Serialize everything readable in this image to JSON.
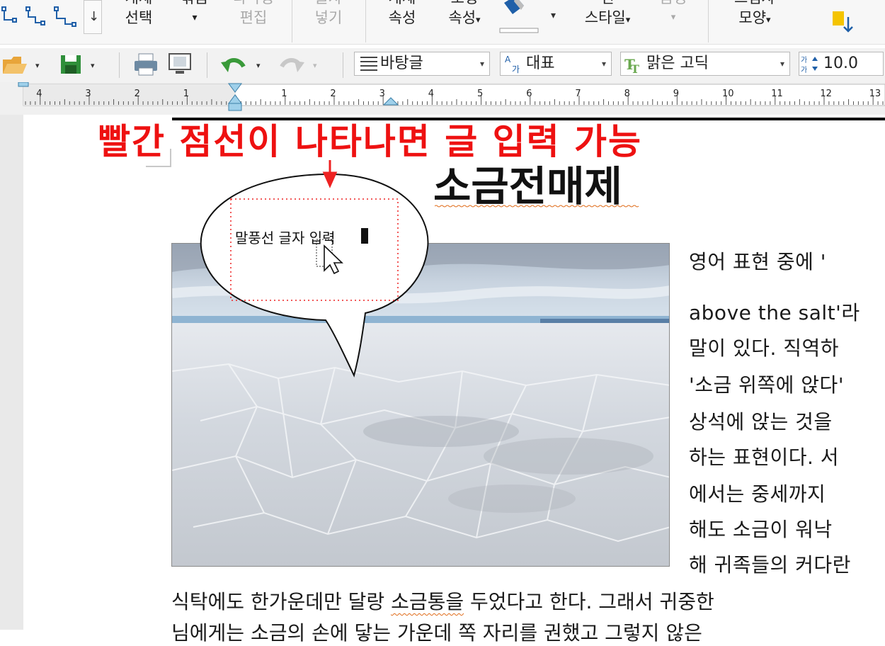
{
  "ribbon": {
    "group1_label": "",
    "items": [
      {
        "line1": "개체",
        "line2": "선택",
        "disabled": false
      },
      {
        "line1": "묶음",
        "line2": "",
        "disabled": false
      },
      {
        "line1": "다각형",
        "line2": "편집",
        "disabled": true
      },
      {
        "line1": "글자",
        "line2": "넣기",
        "disabled": true
      },
      {
        "line1": "개체",
        "line2": "속성",
        "disabled": false
      },
      {
        "line1": "도형",
        "line2": "속성",
        "disabled": false
      },
      {
        "line1": "선",
        "line2": "스타일",
        "disabled": false
      },
      {
        "line1": "음영",
        "line2": "",
        "disabled": true
      },
      {
        "line1": "그림자",
        "line2": "모양",
        "disabled": false
      }
    ],
    "dropdown_glyph": "▾",
    "down_arrow_glyph": "↓"
  },
  "toolbar": {
    "style_combo": "바탕글",
    "lang_combo": "대표",
    "font_combo": "맑은 고딕",
    "size_value": "10.0"
  },
  "ruler": {
    "left_numbers": [
      "4",
      "3",
      "2",
      "1"
    ],
    "right_numbers": [
      "1",
      "2",
      "3",
      "4",
      "5",
      "6",
      "7",
      "8",
      "9",
      "10",
      "11",
      "12",
      "13"
    ]
  },
  "annotation": "빨간 점선이 나타나면 글 입력 가능",
  "document": {
    "title": "소금전매제",
    "bubble_text": "말풍선 글자 입력",
    "right_lines": [
      "영어 표현 중에 '",
      "above the salt'라",
      "말이 있다. 직역하",
      "'소금 위쪽에 앉다'",
      "상석에 앉는 것을",
      "하는 표현이다. 서",
      "에서는 중세까지",
      "해도 소금이 워낙",
      "해 귀족들의 커다란"
    ],
    "full_line_pre": "식탁에도 한가운데만 달랑 ",
    "full_line_mid": "소금통을",
    "full_line_post": " 두었다고 한다. 그래서 귀중한",
    "partial_line": "님에게는 소금의 손에 닿는 가운데 쪽 자리를 권했고 그렇지 않은"
  },
  "colors": {
    "annotation": "#ee1111",
    "ruler_marker": "#7ab6d8",
    "accent": "#3a6fb0"
  }
}
